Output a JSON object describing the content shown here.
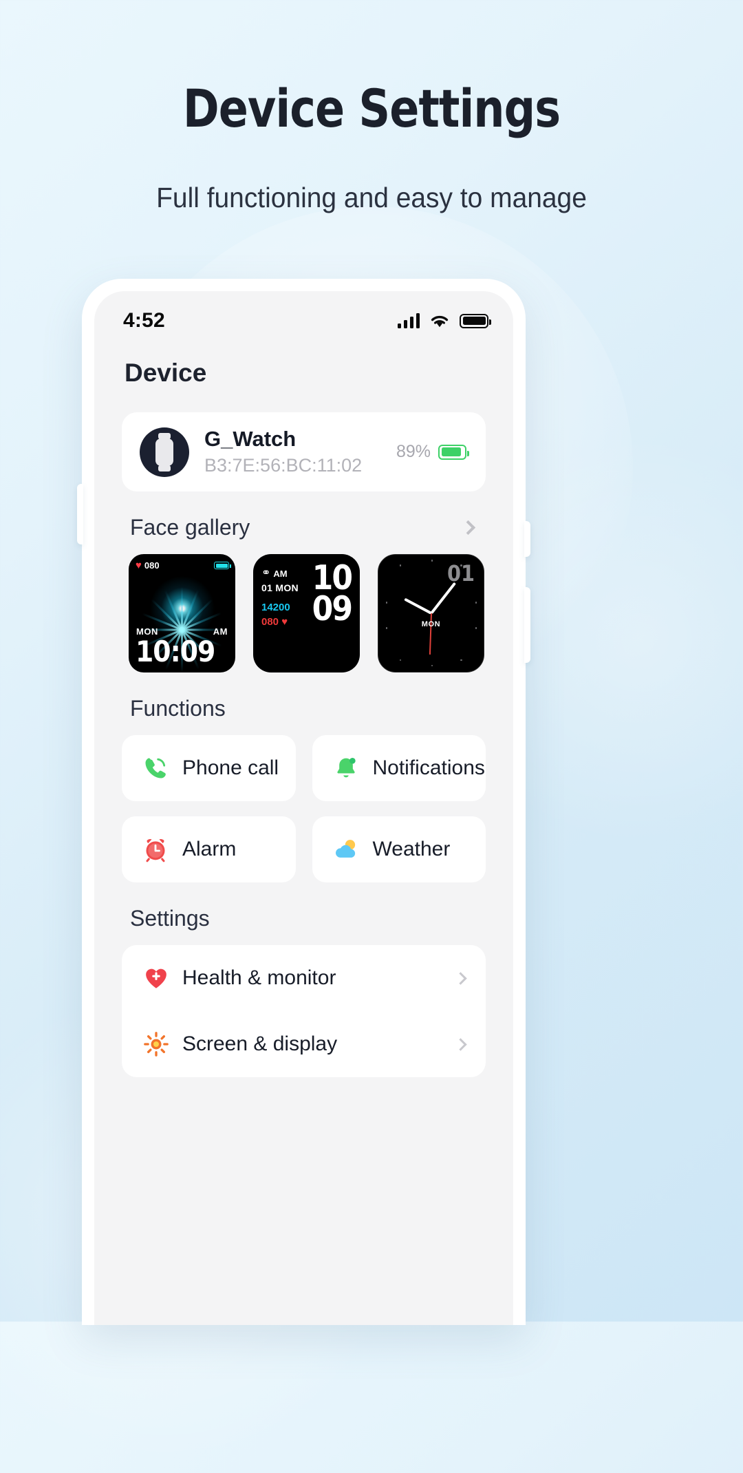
{
  "hero": {
    "title": "Device Settings",
    "subtitle": "Full functioning and easy to manage"
  },
  "statusbar": {
    "time": "4:52",
    "signal_icon": "signal-bars-icon",
    "wifi_icon": "wifi-icon",
    "battery_icon": "battery-full-icon"
  },
  "page": {
    "title": "Device"
  },
  "device_card": {
    "name": "G_Watch",
    "mac": "B3:7E:56:BC:11:02",
    "battery_percent": "89%",
    "battery_level": 89,
    "battery_color": "#3dd167",
    "avatar_icon": "watch-icon"
  },
  "face_gallery": {
    "title": "Face gallery",
    "chevron_icon": "chevron-right-icon",
    "faces": [
      {
        "name": "flower-watch-face",
        "heart_rate": "080",
        "heart_icon": "heart-icon",
        "battery_icon": "battery-icon",
        "day": "MON",
        "meridiem": "AM",
        "time": "10:09",
        "accent": "#22e0e8"
      },
      {
        "name": "digital-watch-face",
        "link_icon": "link-icon",
        "meridiem": "AM",
        "date": "01 MON",
        "steps": "14200",
        "steps_color": "#18c8f0",
        "heart_rate": "080",
        "heart_icon": "heart-icon",
        "heart_color": "#f03a3a",
        "hour": "10",
        "minute": "09"
      },
      {
        "name": "analog-watch-face",
        "number": "01",
        "day": "MON",
        "second_hand_color": "#e0413a"
      }
    ]
  },
  "functions": {
    "title": "Functions",
    "items": [
      {
        "label": "Phone call",
        "icon": "phone-icon",
        "color": "#4ad36a"
      },
      {
        "label": "Notifications",
        "icon": "bell-icon",
        "color": "#4ad36a"
      },
      {
        "label": "Alarm",
        "icon": "alarm-clock-icon",
        "color": "#f04b4b"
      },
      {
        "label": "Weather",
        "icon": "weather-cloud-icon",
        "color": "#5ec8f5"
      }
    ]
  },
  "settings": {
    "title": "Settings",
    "items": [
      {
        "label": "Health & monitor",
        "icon": "heart-plus-icon",
        "color": "#f0424c",
        "chevron": "chevron-right-icon"
      },
      {
        "label": "Screen & display",
        "icon": "brightness-icon",
        "color": "#f2742a",
        "chevron": "chevron-right-icon"
      }
    ]
  }
}
